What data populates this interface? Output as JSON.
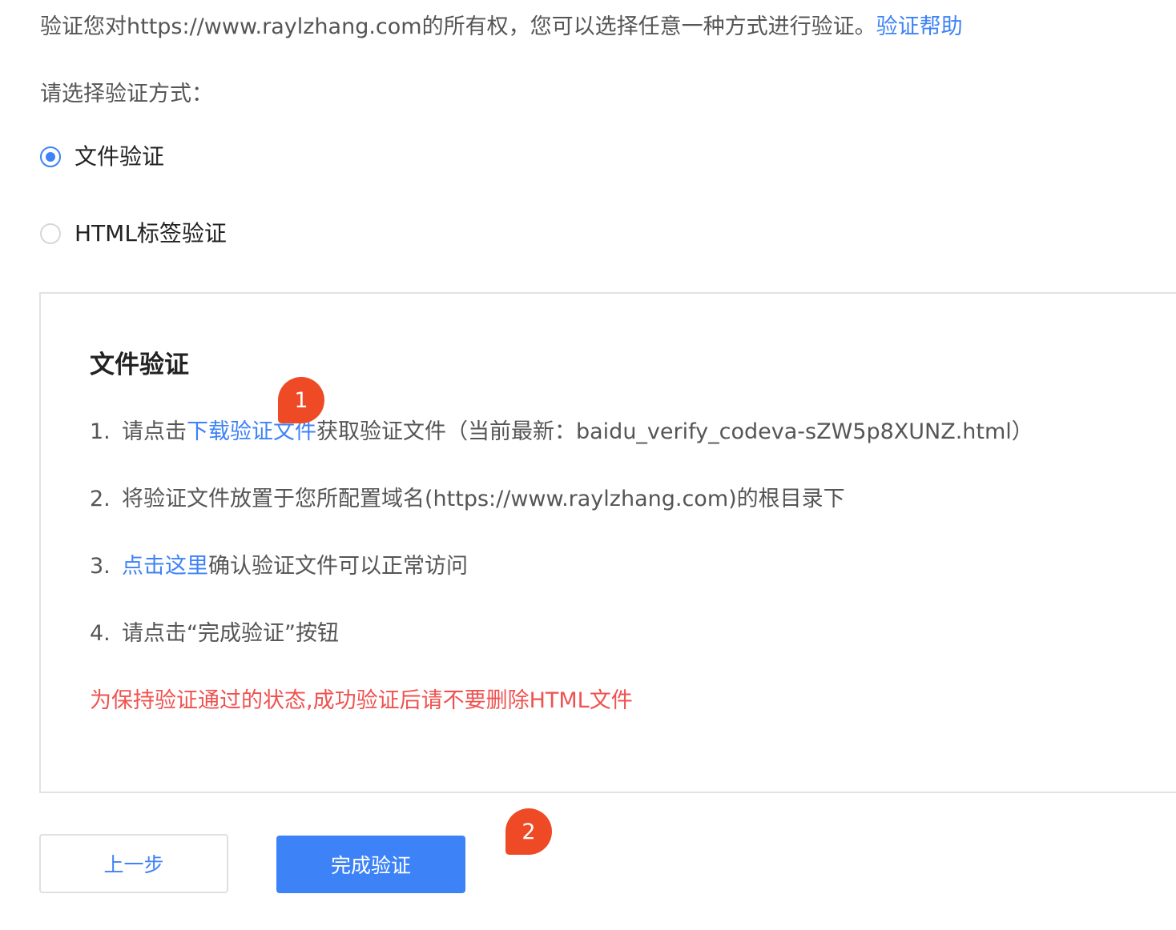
{
  "header": {
    "intro_text": "验证您对https://www.raylzhang.com的所有权，您可以选择任意一种方式进行验证。",
    "help_link": "验证帮助",
    "choose_label": "请选择验证方式："
  },
  "methods": [
    {
      "label": "文件验证",
      "selected": true
    },
    {
      "label": "HTML标签验证",
      "selected": false
    }
  ],
  "panel": {
    "title": "文件验证",
    "steps": [
      {
        "num": "1.",
        "before": "请点击",
        "link": "下载验证文件",
        "after": "获取验证文件（当前最新：baidu_verify_codeva-sZW5p8XUNZ.html）"
      },
      {
        "num": "2.",
        "text": "将验证文件放置于您所配置域名(https://www.raylzhang.com)的根目录下"
      },
      {
        "num": "3.",
        "link": "点击这里",
        "after": "确认验证文件可以正常访问"
      },
      {
        "num": "4.",
        "text": "请点击“完成验证”按钮"
      }
    ],
    "warning": "为保持验证通过的状态,成功验证后请不要删除HTML文件"
  },
  "buttons": {
    "prev": "上一步",
    "done": "完成验证"
  },
  "annotations": {
    "badge1": "1",
    "badge2": "2"
  },
  "colors": {
    "link": "#3d82f7",
    "primary_button": "#3d82f7",
    "warning": "#f0524f",
    "badge": "#ee4a26"
  }
}
